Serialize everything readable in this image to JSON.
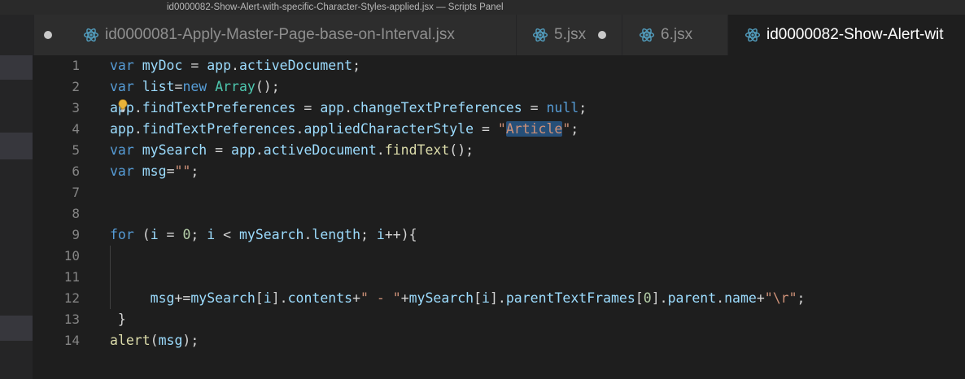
{
  "window": {
    "title": "id0000082-Show-Alert-with-specific-Character-Styles-applied.jsx — Scripts Panel"
  },
  "tabs": [
    {
      "label": "id0000081-Apply-Master-Page-base-on-Interval.jsx",
      "dirty": true,
      "active": false
    },
    {
      "label": "5.jsx",
      "dirty": true,
      "active": false
    },
    {
      "label": "6.jsx",
      "dirty": false,
      "active": false
    },
    {
      "label": "id0000082-Show-Alert-wit",
      "dirty": false,
      "active": true
    }
  ],
  "icons": {
    "tab_icon": "react-atom-icon",
    "lightbulb": "lightbulb-icon",
    "unsaved_dot": "unsaved-dot-icon"
  },
  "colors": {
    "keyword": "#569cd6",
    "identifier": "#9cdcfe",
    "function": "#dcdcaa",
    "class": "#4ec9b0",
    "string": "#ce9178",
    "number": "#b5cea8",
    "tab_icon": "#519aba",
    "selection": "#264f78"
  },
  "editor": {
    "line_numbers": [
      "1",
      "2",
      "3",
      "4",
      "5",
      "6",
      "7",
      "8",
      "9",
      "10",
      "11",
      "12",
      "13",
      "14"
    ],
    "lines": [
      [
        {
          "t": "var",
          "c": "kw"
        },
        {
          "t": " "
        },
        {
          "t": "myDoc",
          "c": "id"
        },
        {
          "t": " = "
        },
        {
          "t": "app",
          "c": "id"
        },
        {
          "t": "."
        },
        {
          "t": "activeDocument",
          "c": "id"
        },
        {
          "t": ";"
        }
      ],
      [
        {
          "t": "var",
          "c": "kw"
        },
        {
          "t": " "
        },
        {
          "t": "list",
          "c": "id"
        },
        {
          "t": "="
        },
        {
          "t": "new",
          "c": "kw"
        },
        {
          "t": " "
        },
        {
          "t": "Array",
          "c": "cls"
        },
        {
          "t": "();"
        }
      ],
      [
        {
          "t": "app",
          "c": "id"
        },
        {
          "t": "."
        },
        {
          "t": "findTextPreferences",
          "c": "id"
        },
        {
          "t": " = "
        },
        {
          "t": "app",
          "c": "id"
        },
        {
          "t": "."
        },
        {
          "t": "changeTextPreferences",
          "c": "id"
        },
        {
          "t": " = "
        },
        {
          "t": "null",
          "c": "kw"
        },
        {
          "t": ";"
        }
      ],
      [
        {
          "t": "app",
          "c": "id"
        },
        {
          "t": "."
        },
        {
          "t": "findTextPreferences",
          "c": "id"
        },
        {
          "t": "."
        },
        {
          "t": "appliedCharacterStyle",
          "c": "id"
        },
        {
          "t": " = "
        },
        {
          "t": "\"",
          "c": "str"
        },
        {
          "t": "Article",
          "c": "str hl"
        },
        {
          "t": "\"",
          "c": "str"
        },
        {
          "t": ";"
        }
      ],
      [
        {
          "t": "var",
          "c": "kw"
        },
        {
          "t": " "
        },
        {
          "t": "mySearch",
          "c": "id"
        },
        {
          "t": " = "
        },
        {
          "t": "app",
          "c": "id"
        },
        {
          "t": "."
        },
        {
          "t": "activeDocument",
          "c": "id"
        },
        {
          "t": "."
        },
        {
          "t": "findText",
          "c": "fn"
        },
        {
          "t": "();"
        }
      ],
      [
        {
          "t": "var",
          "c": "kw"
        },
        {
          "t": " "
        },
        {
          "t": "msg",
          "c": "id"
        },
        {
          "t": "="
        },
        {
          "t": "\"\"",
          "c": "str"
        },
        {
          "t": ";"
        }
      ],
      [],
      [],
      [
        {
          "t": "for",
          "c": "kw"
        },
        {
          "t": " ("
        },
        {
          "t": "i",
          "c": "id"
        },
        {
          "t": " = "
        },
        {
          "t": "0",
          "c": "num"
        },
        {
          "t": "; "
        },
        {
          "t": "i",
          "c": "id"
        },
        {
          "t": " < "
        },
        {
          "t": "mySearch",
          "c": "id"
        },
        {
          "t": "."
        },
        {
          "t": "length",
          "c": "id"
        },
        {
          "t": "; "
        },
        {
          "t": "i",
          "c": "id"
        },
        {
          "t": "++){"
        }
      ],
      [],
      [],
      [
        {
          "t": "     "
        },
        {
          "t": "msg",
          "c": "id"
        },
        {
          "t": "+="
        },
        {
          "t": "mySearch",
          "c": "id"
        },
        {
          "t": "["
        },
        {
          "t": "i",
          "c": "id"
        },
        {
          "t": "]."
        },
        {
          "t": "contents",
          "c": "id"
        },
        {
          "t": "+"
        },
        {
          "t": "\" - \"",
          "c": "str"
        },
        {
          "t": "+"
        },
        {
          "t": "mySearch",
          "c": "id"
        },
        {
          "t": "["
        },
        {
          "t": "i",
          "c": "id"
        },
        {
          "t": "]."
        },
        {
          "t": "parentTextFrames",
          "c": "id"
        },
        {
          "t": "["
        },
        {
          "t": "0",
          "c": "num"
        },
        {
          "t": "]."
        },
        {
          "t": "parent",
          "c": "id"
        },
        {
          "t": "."
        },
        {
          "t": "name",
          "c": "id"
        },
        {
          "t": "+"
        },
        {
          "t": "\"\\r\"",
          "c": "str"
        },
        {
          "t": ";"
        }
      ],
      [
        {
          "t": " }"
        }
      ],
      [
        {
          "t": "alert",
          "c": "fn"
        },
        {
          "t": "("
        },
        {
          "t": "msg",
          "c": "id"
        },
        {
          "t": ");"
        }
      ]
    ]
  }
}
